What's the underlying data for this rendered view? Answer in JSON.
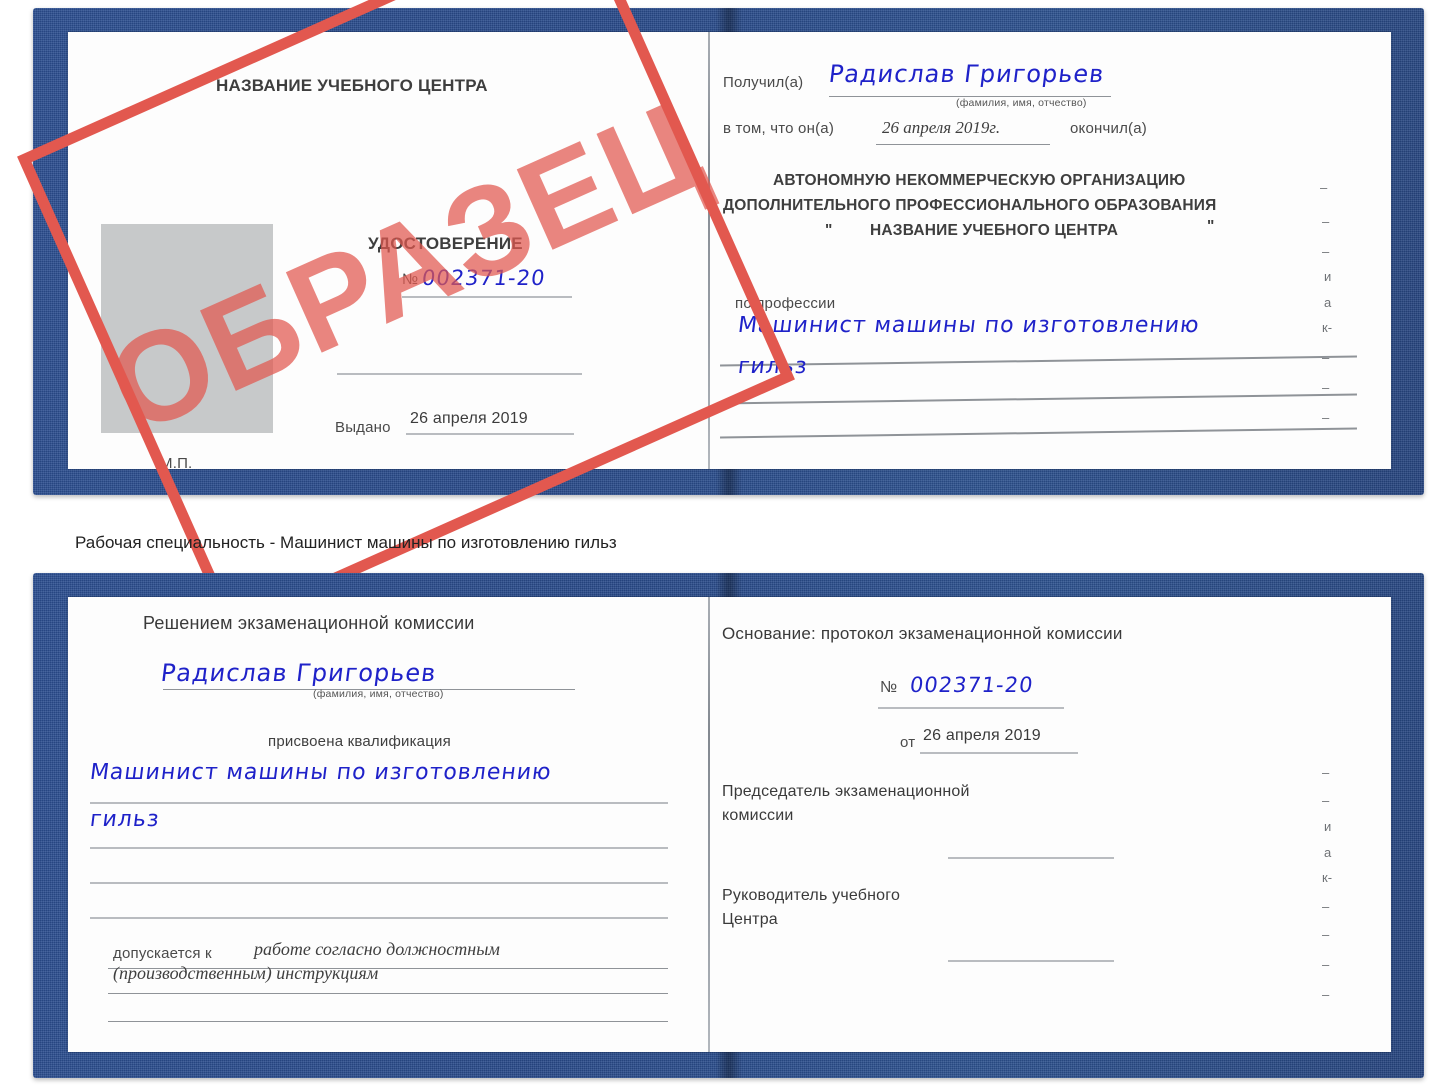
{
  "meta": {
    "stamp_text": "ОБРАЗЕЦ",
    "stamp_color": "#e2584f",
    "cover_color": "#2c4f91",
    "ink_color": "#1f22c9"
  },
  "caption": "Рабочая специальность - Машинист машины по изготовлению гильз",
  "certificate_front": {
    "left_page": {
      "header": "НАЗВАНИЕ УЧЕБНОГО ЦЕНТРА",
      "doc_type": "УДОСТОВЕРЕНИЕ",
      "number_label": "№",
      "number_value": "002371-20",
      "issued_label": "Выдано",
      "issued_value": "26 апреля 2019",
      "seal_label": "М.П."
    },
    "right_page": {
      "received_label": "Получил(а)",
      "received_name": "Радислав Григорьев",
      "name_hint": "(фамилия, имя, отчество)",
      "that_he_label": "в том, что он(а)",
      "completion_date": "26 апреля 2019г.",
      "finished_label": "окончил(а)",
      "org_line1": "АВТОНОМНУЮ НЕКОММЕРЧЕСКУЮ ОРГАНИЗАЦИЮ",
      "org_line2": "ДОПОЛНИТЕЛЬНОГО ПРОФЕССИОНАЛЬНОГО ОБРАЗОВАНИЯ",
      "org_quote_open": "\"",
      "org_line3": "НАЗВАНИЕ УЧЕБНОГО ЦЕНТРА",
      "org_quote_close": "\"",
      "profession_label": "по профессии",
      "profession_value_line1": "Машинист машины по изготовлению",
      "profession_value_line2": "гильз"
    }
  },
  "certificate_back": {
    "left_page": {
      "heading": "Решением экзаменационной комиссии",
      "name_value": "Радислав Григорьев",
      "name_hint": "(фамилия, имя, отчество)",
      "qualification_label": "присвоена квалификация",
      "qualification_line1": "Машинист машины по изготовлению",
      "qualification_line2": "гильз",
      "admitted_label": "допускается к",
      "admitted_line1": "работе согласно должностным",
      "admitted_line2": "(производственным) инструкциям"
    },
    "right_page": {
      "basis_label": "Основание: протокол экзаменационной комиссии",
      "number_label": "№",
      "number_value": "002371-20",
      "date_label": "от",
      "date_value": "26 апреля 2019",
      "chairman_line1": "Председатель экзаменационной",
      "chairman_line2": "комиссии",
      "director_line1": "Руководитель учебного",
      "director_line2": "Центра"
    }
  },
  "edge_fragments_top": [
    "–",
    "–",
    "–",
    "и",
    "а",
    "к-",
    "–",
    "–",
    "–"
  ],
  "edge_fragments_bottom": [
    "–",
    "–",
    "и",
    "а",
    "к-",
    "–",
    "–",
    "–",
    "–"
  ]
}
